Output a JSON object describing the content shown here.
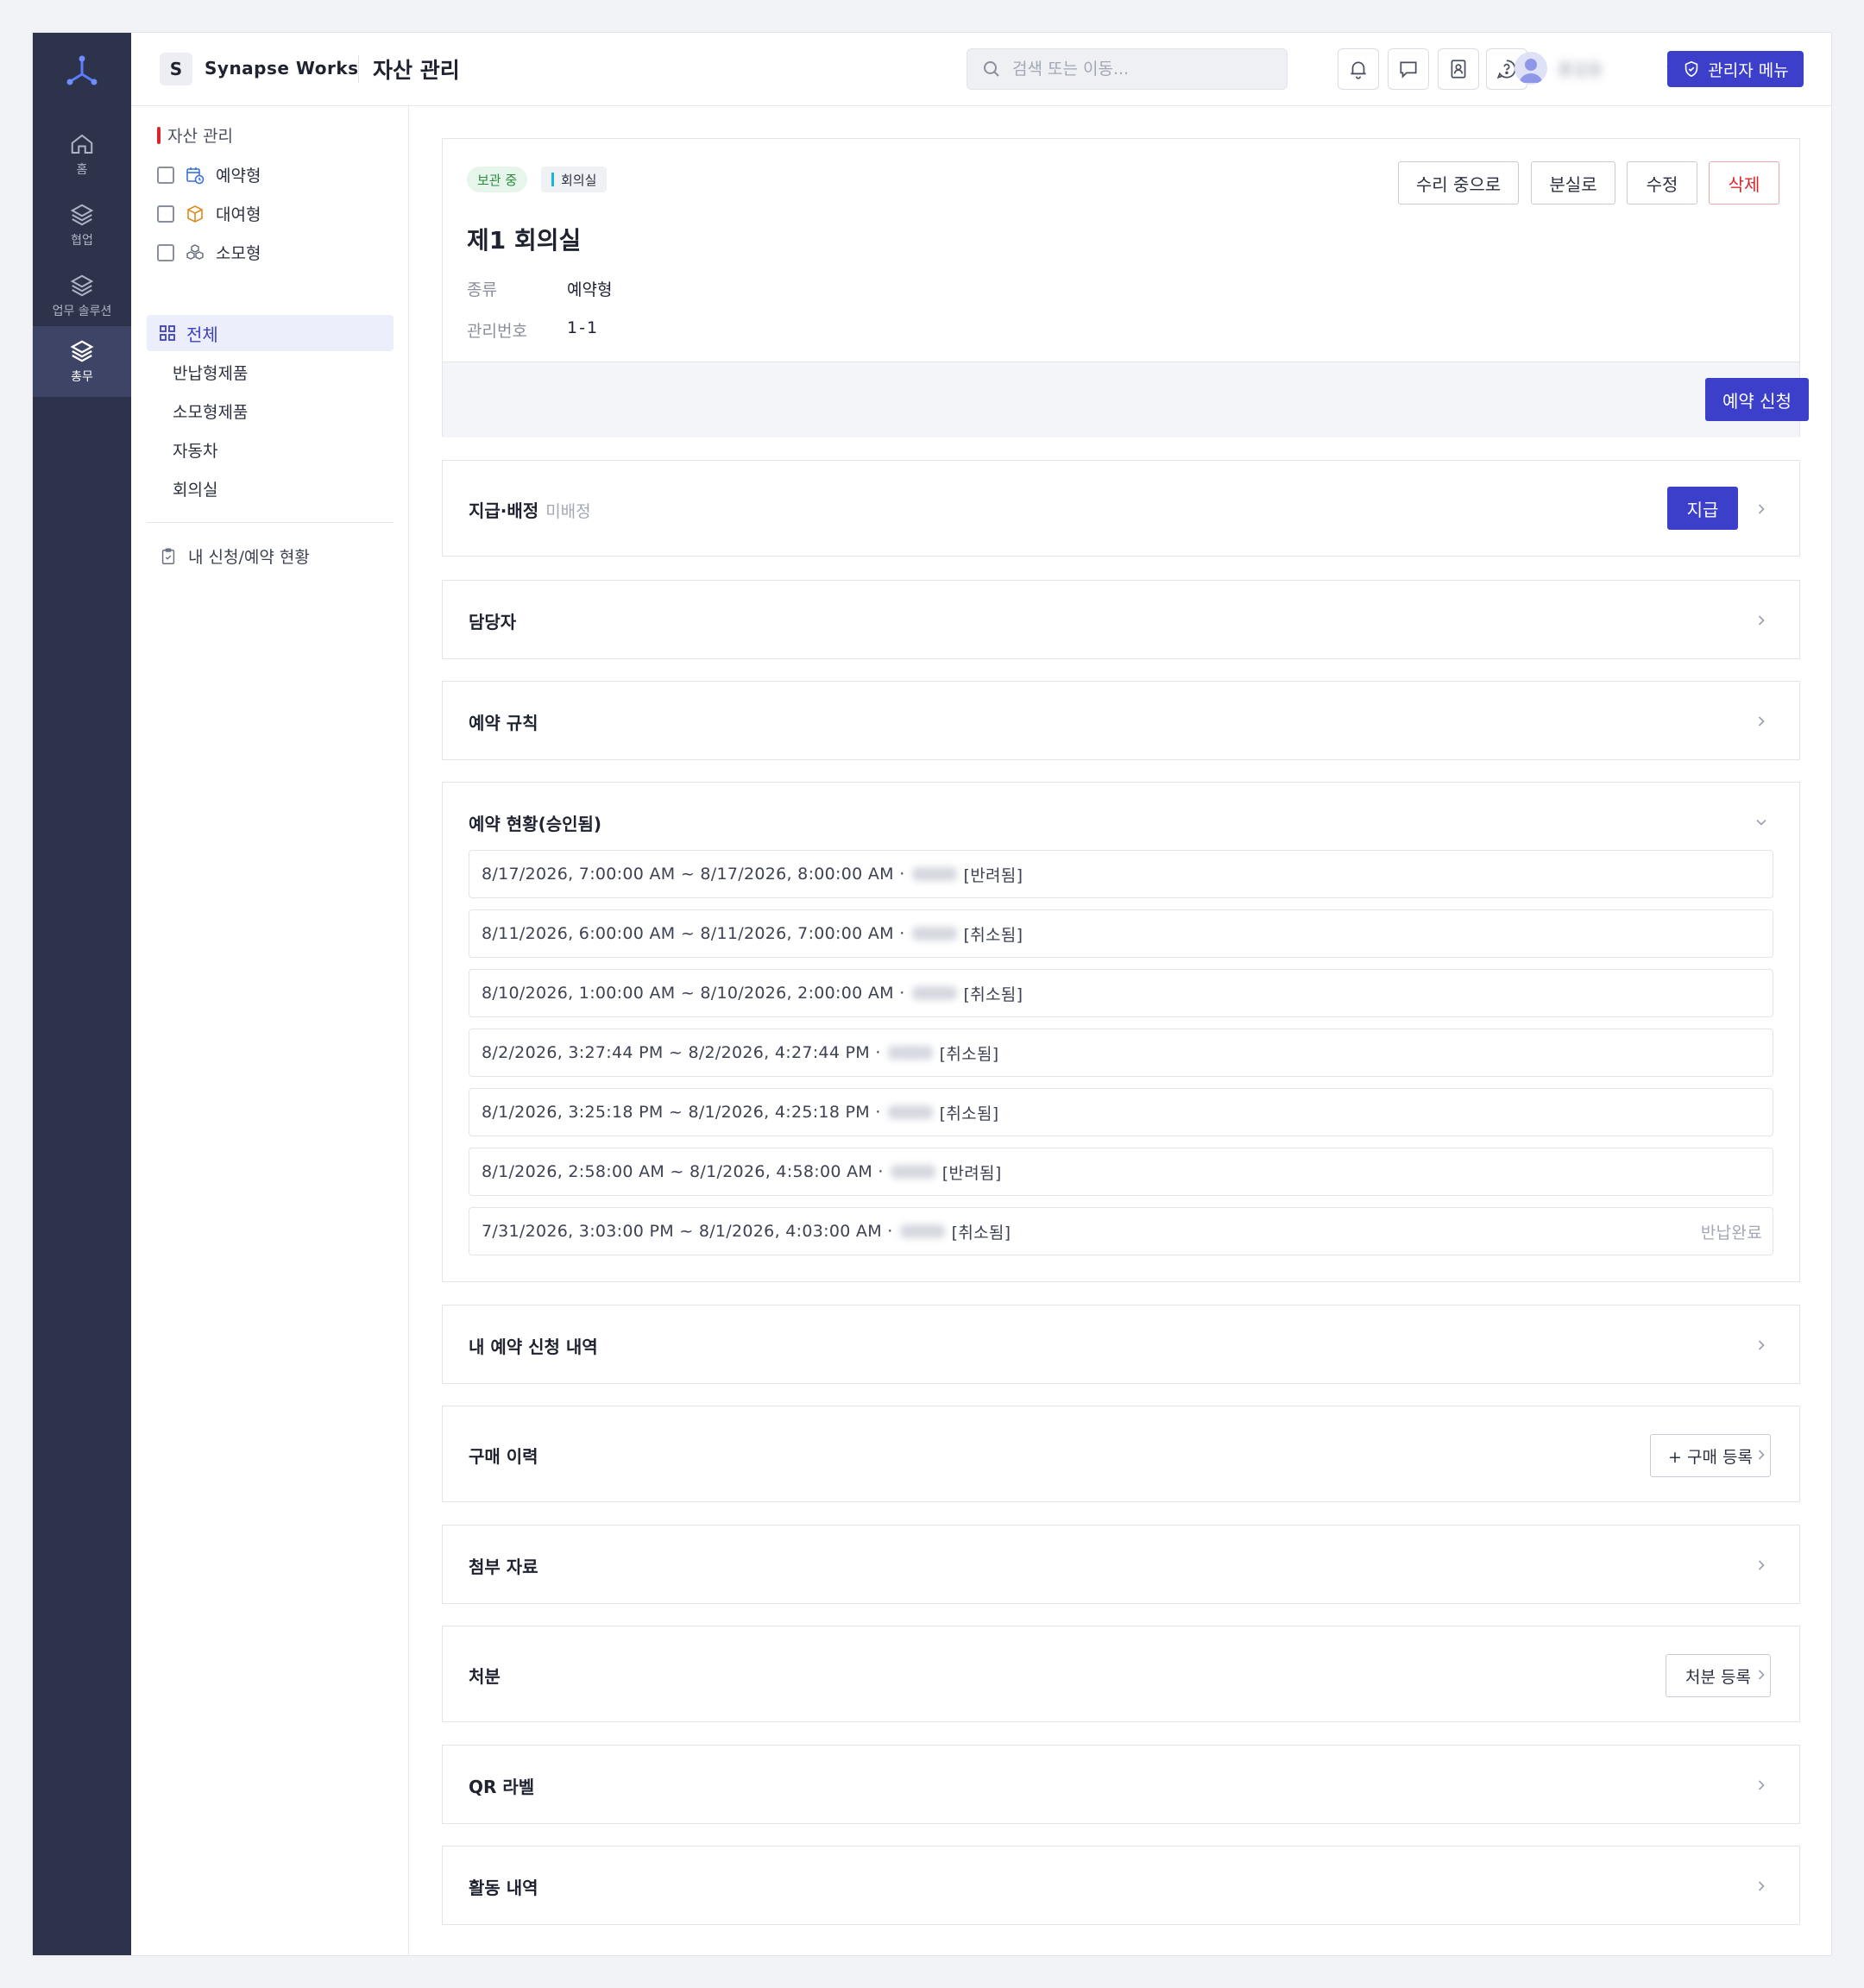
{
  "workspace": {
    "initial": "S",
    "name": "Synapse Works"
  },
  "page_title": "자산 관리",
  "search": {
    "placeholder": "검색 또는 이동..."
  },
  "user": {
    "name": "홍길동"
  },
  "admin_button": "관리자 메뉴",
  "rail": [
    {
      "label": "홈"
    },
    {
      "label": "협업"
    },
    {
      "label": "업무 솔루션"
    },
    {
      "label": "총무"
    }
  ],
  "sidebar": {
    "section": "자산 관리",
    "types": [
      {
        "label": "예약형"
      },
      {
        "label": "대여형"
      },
      {
        "label": "소모형"
      }
    ],
    "all": "전체",
    "categories": [
      "반납형제품",
      "소모형제품",
      "자동차",
      "회의실"
    ],
    "my_requests": "내 신청/예약 현황"
  },
  "asset": {
    "status": "보관 중",
    "category": "회의실",
    "name": "제1 회의실",
    "meta": [
      {
        "key": "종류",
        "value": "예약형"
      },
      {
        "key": "관리번호",
        "value": "1-1"
      }
    ],
    "actions": {
      "repair": "수리 중으로",
      "lost": "분실로",
      "edit": "수정",
      "delete": "삭제"
    },
    "reserve": "예약 신청"
  },
  "sections": {
    "assign": {
      "title": "지급·배정",
      "sub": "미배정",
      "action": "지급"
    },
    "manager": {
      "title": "담당자"
    },
    "rules": {
      "title": "예약 규칙"
    },
    "status": {
      "title": "예약 현황(승인됨)",
      "rows": [
        {
          "range": "8/17/2026, 7:00:00 AM ~ 8/17/2026, 8:00:00 AM ·",
          "state": "[반려됨]",
          "extra": ""
        },
        {
          "range": "8/11/2026, 6:00:00 AM ~ 8/11/2026, 7:00:00 AM ·",
          "state": "[취소됨]",
          "extra": ""
        },
        {
          "range": "8/10/2026, 1:00:00 AM ~ 8/10/2026, 2:00:00 AM ·",
          "state": "[취소됨]",
          "extra": ""
        },
        {
          "range": "8/2/2026, 3:27:44 PM ~ 8/2/2026, 4:27:44 PM ·",
          "state": "[취소됨]",
          "extra": ""
        },
        {
          "range": "8/1/2026, 3:25:18 PM ~ 8/1/2026, 4:25:18 PM ·",
          "state": "[취소됨]",
          "extra": ""
        },
        {
          "range": "8/1/2026, 2:58:00 AM ~ 8/1/2026, 4:58:00 AM ·",
          "state": "[반려됨]",
          "extra": ""
        },
        {
          "range": "7/31/2026, 3:03:00 PM ~ 8/1/2026, 4:03:00 AM ·",
          "state": "[취소됨]",
          "extra": "반납완료"
        }
      ]
    },
    "my_reservations": {
      "title": "내 예약 신청 내역"
    },
    "purchase": {
      "title": "구매 이력",
      "action": "+ 구매 등록"
    },
    "attachments": {
      "title": "첨부 자료"
    },
    "disposal": {
      "title": "처분",
      "action": "처분 등록"
    },
    "qr": {
      "title": "QR 라벨"
    },
    "activity": {
      "title": "활동 내역"
    }
  },
  "colors": {
    "primary": "#3b3fc9",
    "rail": "#2d334a",
    "danger": "#d9262c",
    "success": "#2a8a3e"
  }
}
